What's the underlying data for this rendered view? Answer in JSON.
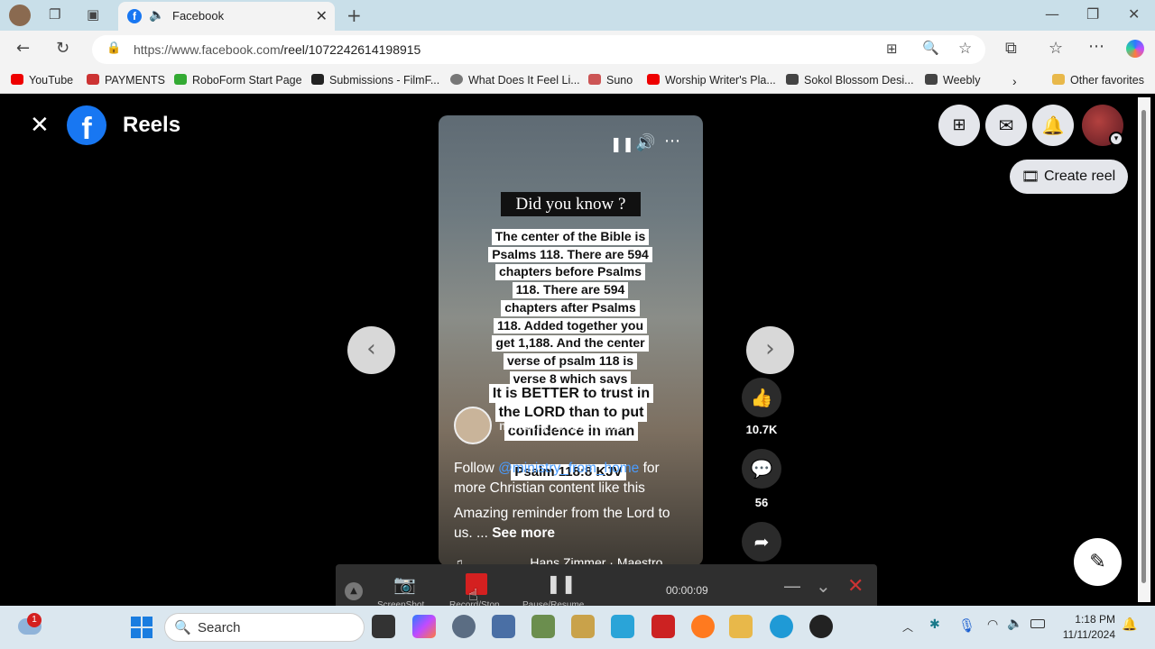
{
  "browser": {
    "tab_title": "Facebook",
    "url_domain": "https://www.facebook.com",
    "url_path": "/reel/1072242614198915",
    "bookmarks": [
      "YouTube",
      "PAYMENTS",
      "RoboForm Start Page",
      "Submissions - FilmF...",
      "What Does It Feel Li...",
      "Suno",
      "Worship Writer's Pla...",
      "Sokol Blossom Desi...",
      "Weebly"
    ],
    "other_favorites": "Other favorites"
  },
  "reels": {
    "title": "Reels",
    "create_reel": "Create reel",
    "did_you_know": "Did you know ?",
    "caption_lines": [
      "The center of the Bible is",
      "Psalms 118. There are 594",
      "chapters before Psalms",
      "118. There are 594",
      "chapters after Psalms",
      "118. Added together you",
      "get 1,188. And the center",
      "verse of psalm 118 is",
      "verse 8 which says"
    ],
    "quote_lines": [
      "It is BETTER to trust in",
      "the LORD than to put",
      "confidence in man"
    ],
    "verse_ref": "Psalm 118:8 KJV",
    "author": "ministry_from_home",
    "desc_follow": "Follow",
    "desc_handle": "@ministry_from_home",
    "desc_rest": "for more Christian content like this",
    "desc2": "Amazing reminder from the Lord to us. ...",
    "see_more": "See more",
    "music": "Hans Zimmer · Maestro",
    "likes": "10.7K",
    "comments": "56"
  },
  "recorder": {
    "screenshot": "ScreenShot",
    "record_stop": "Record/Stop",
    "pause_resume": "Pause/Resume",
    "time": "00:00:09"
  },
  "taskbar": {
    "search": "Search",
    "time": "1:18 PM",
    "date": "11/11/2024",
    "weather_badge": "1"
  },
  "colors": {
    "facebook_blue": "#1877f2",
    "record_red": "#d42020"
  }
}
